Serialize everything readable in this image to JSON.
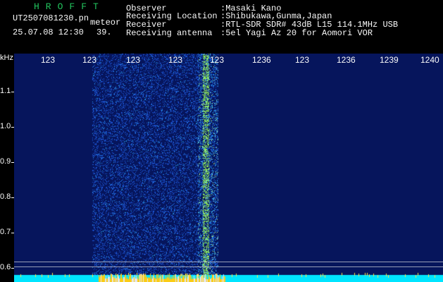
{
  "header": {
    "logo": "HROFFT",
    "filename": "UT2507081230.pn",
    "meteor_label": "meteor",
    "datetime": "25.07.08 12:30",
    "count": "39."
  },
  "meta": {
    "observer_label": "Observer",
    "observer_value": ":Masaki Kano",
    "location_label": "Receiving Location",
    "location_value": ":Shibukawa,Gunma,Japan",
    "receiver_label": "Receiver",
    "receiver_value": ":RTL-SDR SDR# 43dB L15 114.1MHz USB",
    "antenna_label": "Receiving antenna",
    "antenna_value": ":5el Yagi Az 20 for Aomori VOR"
  },
  "axis": {
    "y_unit": "kHz",
    "y_ticks": [
      "1.1",
      "1.0",
      "0.9",
      "0.8",
      "0.7",
      "0.6"
    ],
    "x_ticks": [
      "123",
      "123",
      "123",
      "123",
      "123",
      "1236",
      "123",
      "1236",
      "1239",
      "1240"
    ]
  },
  "colors": {
    "background": "#000000",
    "logo": "#22c55e",
    "spectrogram_low": "#06155c",
    "spectrogram_mid": "#1d4ed8",
    "spectrogram_high": "#22d3ee",
    "meteor_trace": "#84cc16",
    "bottom_band": "#00e5ff",
    "bottom_signal": "#facc15"
  }
}
